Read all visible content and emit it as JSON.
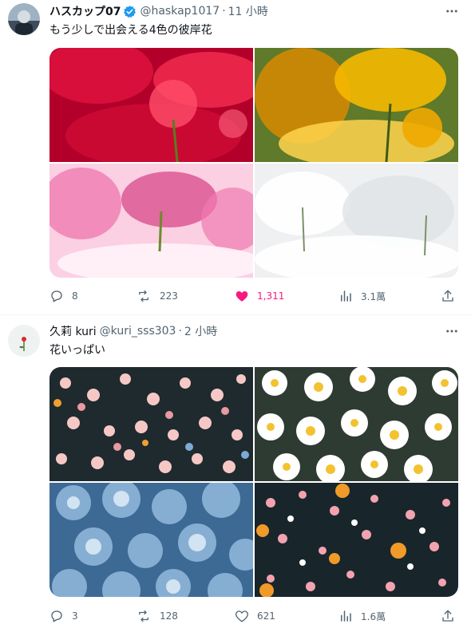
{
  "tweets": [
    {
      "display_name": "ハスカップ07",
      "handle": "@haskap1017",
      "separator": "·",
      "time": "11 小時",
      "text": "もう少しで出会える4色の彼岸花",
      "verified": true,
      "photos": [
        {
          "icon": "red-spider-lily-photo",
          "colors": [
            "#b3002a",
            "#e0133f",
            "#ff3355"
          ]
        },
        {
          "icon": "yellow-spider-lily-photo",
          "colors": [
            "#d98a00",
            "#f5b800",
            "#ffd34d"
          ]
        },
        {
          "icon": "pink-spider-lily-photo",
          "colors": [
            "#d8488a",
            "#f07bb0",
            "#fbd0e3"
          ]
        },
        {
          "icon": "white-spider-lily-photo",
          "colors": [
            "#c8ccd1",
            "#eef0f2",
            "#ffffff"
          ]
        }
      ],
      "actions": {
        "replies": "8",
        "retweets": "223",
        "likes": "1,311",
        "views": "3.1萬",
        "liked": true
      }
    },
    {
      "display_name": "久莉 kuri",
      "handle": "@kuri_sss303",
      "separator": "·",
      "time": "2 小時",
      "text": "花いっぱい",
      "verified": false,
      "photos": [
        {
          "icon": "pink-flower-field-photo",
          "colors": [
            "#1e2a2e",
            "#e89aa0",
            "#f6c8c5"
          ]
        },
        {
          "icon": "white-daisy-photo",
          "colors": [
            "#2d3b33",
            "#ffffff",
            "#f2c230"
          ]
        },
        {
          "icon": "blue-hydrangea-photo",
          "colors": [
            "#3d6a94",
            "#86aed3",
            "#d2e3f2"
          ]
        },
        {
          "icon": "mixed-flower-field-photo",
          "colors": [
            "#18262b",
            "#f3a3b0",
            "#f09a2a"
          ]
        }
      ],
      "actions": {
        "replies": "3",
        "retweets": "128",
        "likes": "621",
        "views": "1.6萬",
        "liked": false
      }
    }
  ],
  "colors": {
    "like_active": "#f91880",
    "verified": "#1d9bf0",
    "muted": "#536471"
  }
}
